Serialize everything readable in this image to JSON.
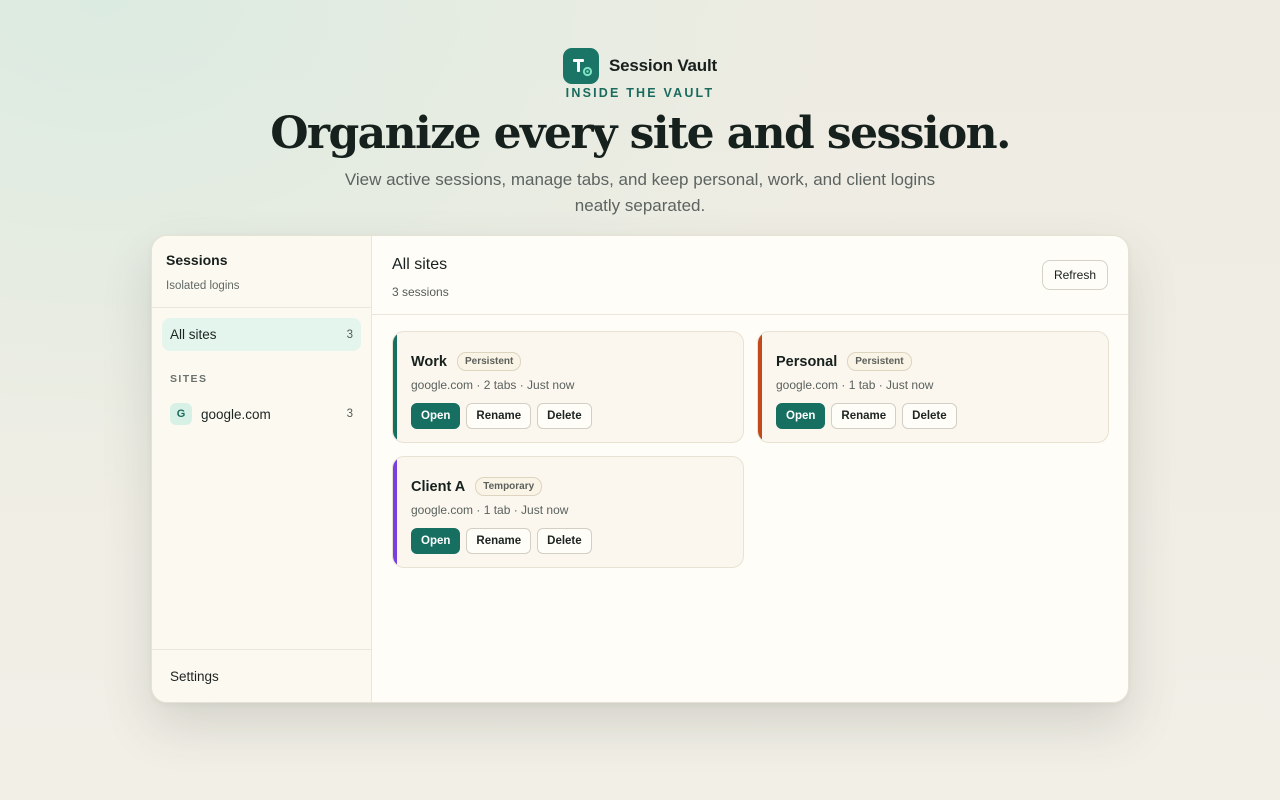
{
  "brand": {
    "name": "Session Vault",
    "icon": "vault-logo-icon"
  },
  "hero": {
    "eyebrow": "INSIDE THE VAULT",
    "title": "Organize every site and session.",
    "subtitle": "View active sessions, manage tabs, and keep personal, work, and client logins neatly separated."
  },
  "sidebar": {
    "title": "Sessions",
    "subtitle": "Isolated logins",
    "all_sites": {
      "label": "All sites",
      "count": "3"
    },
    "section_label": "SITES",
    "sites": [
      {
        "avatar": "G",
        "label": "google.com",
        "count": "3"
      }
    ],
    "settings_label": "Settings"
  },
  "main": {
    "title": "All sites",
    "subtitle": "3 sessions",
    "refresh_label": "Refresh"
  },
  "sessions": [
    {
      "name": "Work",
      "badge": "Persistent",
      "meta": "google.com · 2 tabs · Just now",
      "color": "#176f61"
    },
    {
      "name": "Personal",
      "badge": "Persistent",
      "meta": "google.com · 1 tab · Just now",
      "color": "#c04a1a"
    },
    {
      "name": "Client A",
      "badge": "Temporary",
      "meta": "google.com · 1 tab · Just now",
      "color": "#7a3fe0"
    }
  ],
  "actions": {
    "open": "Open",
    "rename": "Rename",
    "delete": "Delete"
  },
  "colors": {
    "accent": "#176f61",
    "background": "#f0eee5"
  }
}
